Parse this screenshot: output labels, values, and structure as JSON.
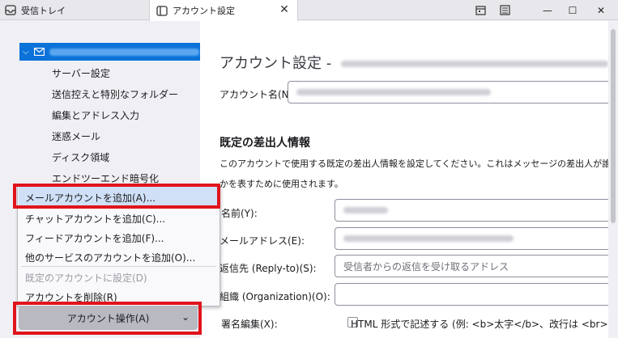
{
  "tabs": [
    {
      "label": "受信トレイ",
      "icon": "inbox-icon"
    },
    {
      "label": "アカウント設定",
      "icon": "settings-tab-icon"
    }
  ],
  "window_controls": {
    "calendar": "calendar-icon",
    "tasks": "tasks-icon",
    "minimize": "—",
    "maximize": "☐",
    "close": "✕"
  },
  "sidebar": {
    "items": [
      {
        "label": "サーバー設定"
      },
      {
        "label": "送信控えと特別なフォルダー"
      },
      {
        "label": "編集とアドレス入力"
      },
      {
        "label": "迷惑メール"
      },
      {
        "label": "ディスク領域"
      },
      {
        "label": "エンドツーエンド暗号化"
      }
    ]
  },
  "context_menu": {
    "items": [
      {
        "label": "メールアカウントを追加(A)...",
        "enabled": true
      },
      {
        "label": "チャットアカウントを追加(C)...",
        "enabled": true
      },
      {
        "label": "フィードアカウントを追加(F)...",
        "enabled": true
      },
      {
        "label": "他のサービスのアカウントを追加(O)...",
        "enabled": true
      },
      {
        "label": "既定のアカウントに設定(D)",
        "enabled": false
      },
      {
        "label": "アカウントを削除(R)",
        "enabled": true
      }
    ]
  },
  "account_actions_label": "アカウント操作(A)",
  "main": {
    "title": "アカウント設定 -",
    "account_name_label": "アカウント名(N):",
    "section_title": "既定の差出人情報",
    "section_desc_1": "このアカウントで使用する既定の差出人情報を設定してください。これはメッセージの差出人が誰",
    "section_desc_2": "かを表すために使用されます。",
    "name_label": "名前(Y):",
    "email_label": "メールアドレス(E):",
    "reply_to_label": "返信先 (Reply-to)(S):",
    "reply_to_placeholder": "受信者からの返信を受け取るアドレス",
    "org_label": "組織 (Organization)(O):",
    "signature_label": "署名編集(X):",
    "html_checkbox_label": "HTML 形式で記述する (例: <b>太字</b>、改行は <br>)("
  },
  "colors": {
    "highlight": "#e0141c",
    "selection": "#0b72d9"
  }
}
